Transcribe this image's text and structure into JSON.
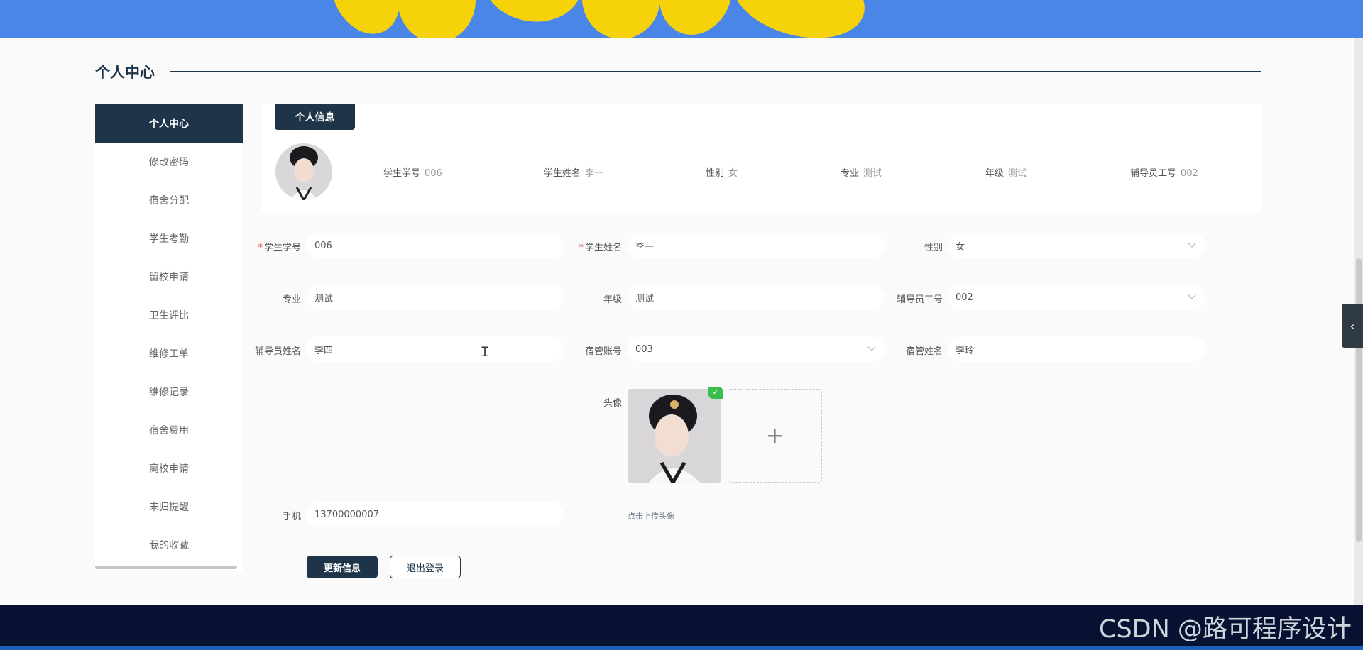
{
  "page_title": "个人中心",
  "sidebar": {
    "items": [
      {
        "label": "个人中心"
      },
      {
        "label": "修改密码"
      },
      {
        "label": "宿舍分配"
      },
      {
        "label": "学生考勤"
      },
      {
        "label": "留校申请"
      },
      {
        "label": "卫生评比"
      },
      {
        "label": "维修工单"
      },
      {
        "label": "维修记录"
      },
      {
        "label": "宿舍费用"
      },
      {
        "label": "离校申请"
      },
      {
        "label": "未归提醒"
      },
      {
        "label": "我的收藏"
      }
    ]
  },
  "info_card": {
    "tab_label": "个人信息",
    "fields": [
      {
        "label": "学生学号",
        "value": "006"
      },
      {
        "label": "学生姓名",
        "value": "李一"
      },
      {
        "label": "性别",
        "value": "女"
      },
      {
        "label": "专业",
        "value": "测试"
      },
      {
        "label": "年级",
        "value": "测试"
      },
      {
        "label": "辅导员工号",
        "value": "002"
      }
    ]
  },
  "form": {
    "student_id": {
      "label": "学生学号",
      "required_mark": "*",
      "value": "006"
    },
    "student_name": {
      "label": "学生姓名",
      "required_mark": "*",
      "value": "李一"
    },
    "gender": {
      "label": "性别",
      "value": "女"
    },
    "major": {
      "label": "专业",
      "value": "测试"
    },
    "grade": {
      "label": "年级",
      "value": "测试"
    },
    "counselor_id": {
      "label": "辅导员工号",
      "value": "002"
    },
    "counselor_name": {
      "label": "辅导员姓名",
      "value": "李四"
    },
    "dorm_manager_account": {
      "label": "宿管账号",
      "value": "003"
    },
    "dorm_manager_name": {
      "label": "宿管姓名",
      "value": "李玲"
    },
    "avatar": {
      "label": "头像",
      "upload_hint": "点击上传头像",
      "add_symbol": "+"
    },
    "phone": {
      "label": "手机",
      "value": "13700000007"
    }
  },
  "buttons": {
    "update": "更新信息",
    "logout": "退出登录"
  },
  "watermark": "CSDN @路可程序设计",
  "colors": {
    "primary": "#1d3449",
    "footer": "#071233",
    "banner_sky": "#4a86e8",
    "banner_flower": "#f5d20a",
    "required": "#e54b4b",
    "upload_ok": "#3bbd4e"
  },
  "icons": {
    "select_arrow": "chevron-down-icon",
    "side_toggle": "chevron-left-icon",
    "text_cursor": "text-cursor-icon",
    "upload_success": "check-icon"
  }
}
